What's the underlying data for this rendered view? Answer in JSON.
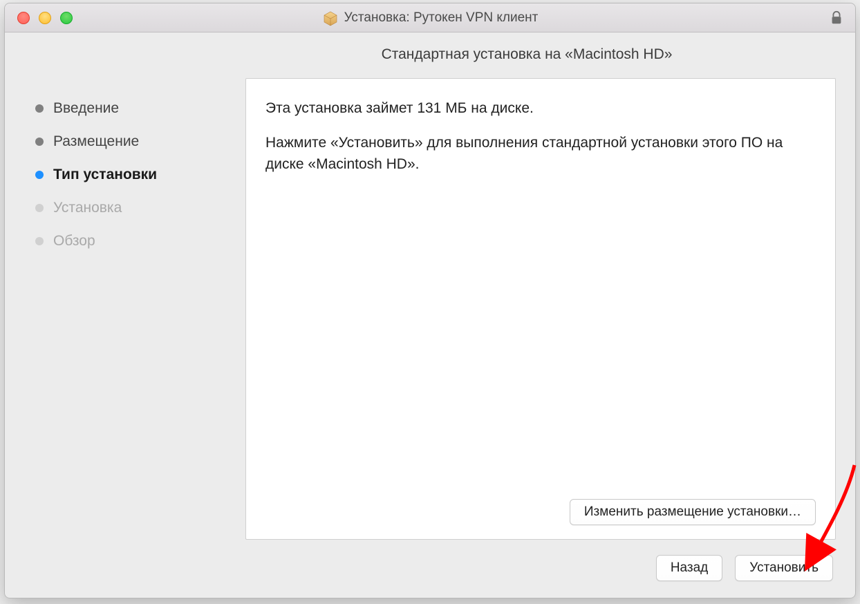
{
  "header": {
    "title": "Установка: Рутокен VPN клиент"
  },
  "page": {
    "heading": "Стандартная установка на «Macintosh HD»"
  },
  "sidebar": {
    "items": [
      {
        "label": "Введение",
        "state": "done"
      },
      {
        "label": "Размещение",
        "state": "done"
      },
      {
        "label": "Тип установки",
        "state": "current"
      },
      {
        "label": "Установка",
        "state": "future"
      },
      {
        "label": "Обзор",
        "state": "future"
      }
    ]
  },
  "content": {
    "disk_line": "Эта установка займет 131 МБ на диске.",
    "instruction_line": "Нажмите «Установить» для выполнения стандартной установки этого ПО на диске «Macintosh HD».",
    "change_location_btn": "Изменить размещение установки…"
  },
  "footer": {
    "back_btn": "Назад",
    "install_btn": "Установить"
  }
}
